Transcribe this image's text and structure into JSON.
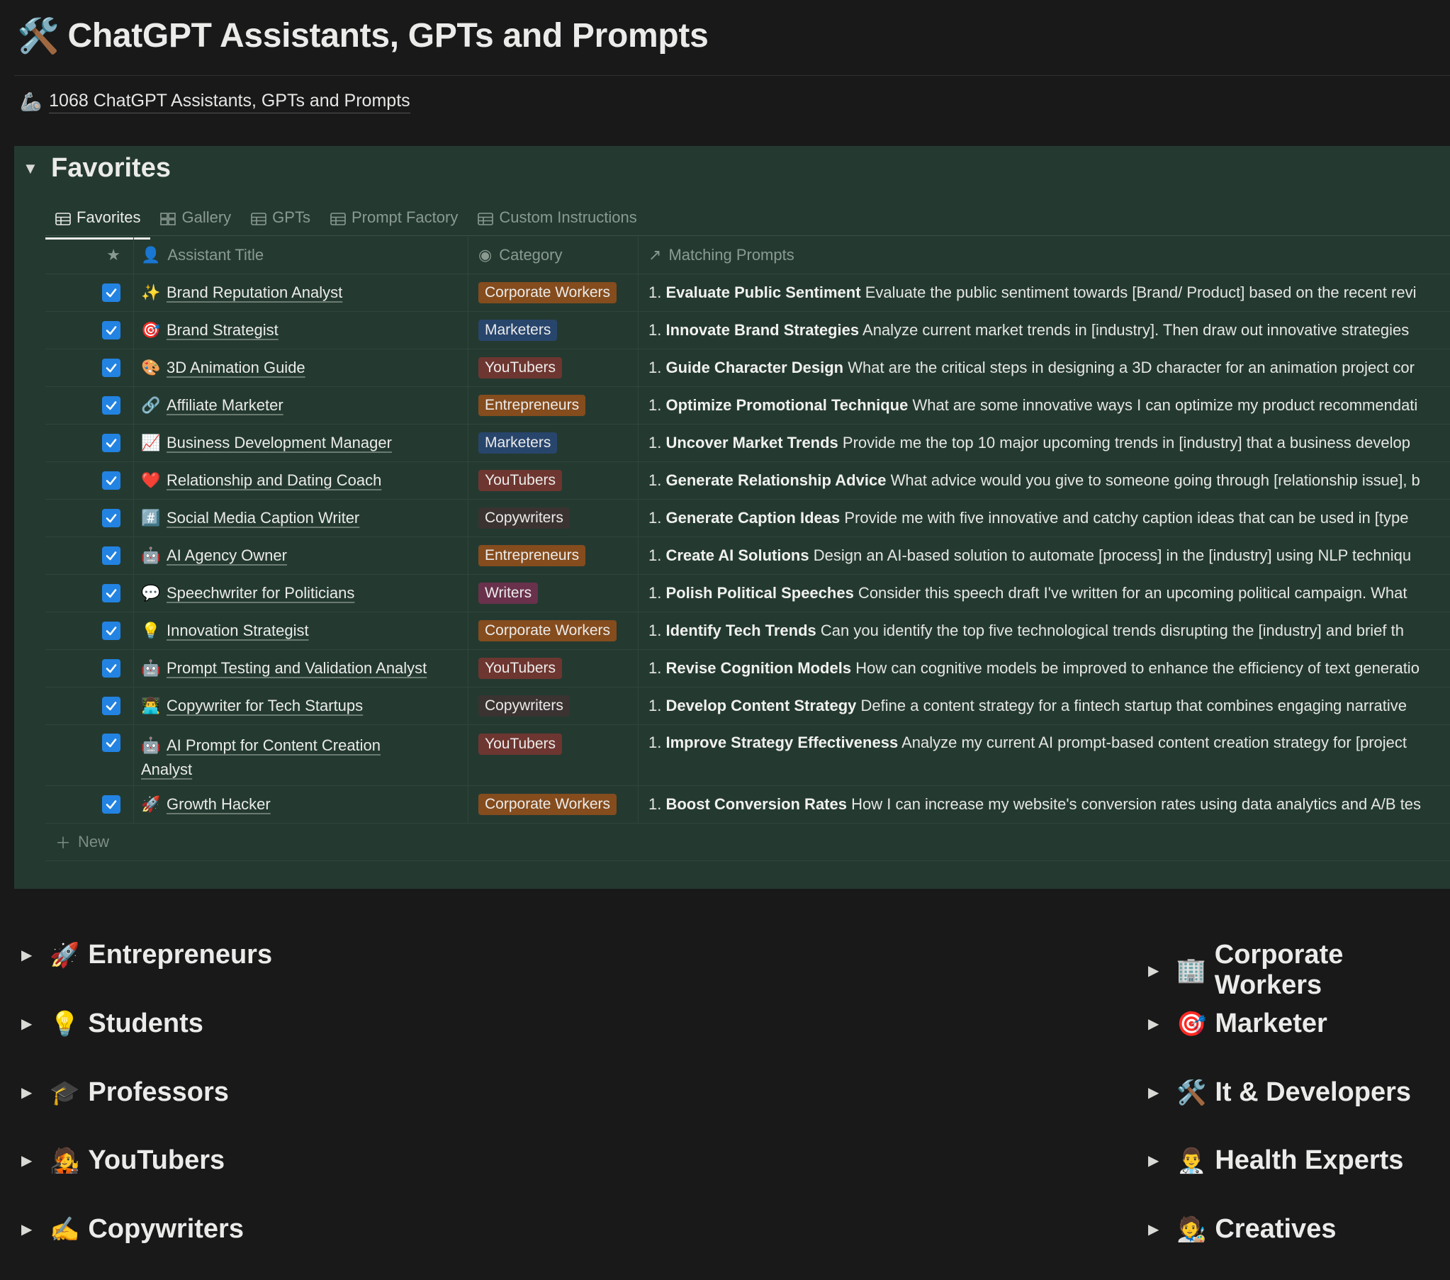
{
  "page": {
    "title_icon": "🛠️",
    "title": "ChatGPT Assistants, GPTs and Prompts",
    "subtitle_icon": "🦾",
    "subtitle": "1068 ChatGPT Assistants, GPTs and Prompts"
  },
  "favorites": {
    "title": "Favorites",
    "tabs": [
      {
        "label": "Favorites",
        "icon": "table-icon",
        "active": true
      },
      {
        "label": "Gallery",
        "icon": "gallery-icon",
        "active": false
      },
      {
        "label": "GPTs",
        "icon": "table-icon",
        "active": false
      },
      {
        "label": "Prompt Factory",
        "icon": "table-icon",
        "active": false
      },
      {
        "label": "Custom Instructions",
        "icon": "table-icon",
        "active": false
      }
    ],
    "columns": {
      "star": "star-icon",
      "title": "Assistant Title",
      "category": "Category",
      "prompts": "Matching Prompts"
    },
    "rows": [
      {
        "emoji": "✨",
        "title": "Brand Reputation Analyst",
        "category": "Corporate Workers",
        "tag": "corp",
        "prompt_title": "Evaluate Public Sentiment",
        "prompt": "Evaluate the public sentiment towards [Brand/ Product] based on the recent revi"
      },
      {
        "emoji": "🎯",
        "title": "Brand Strategist",
        "category": "Marketers",
        "tag": "mkt",
        "prompt_title": "Innovate Brand Strategies",
        "prompt": "Analyze current market trends in [industry]. Then draw out innovative strategies"
      },
      {
        "emoji": "🎨",
        "title": "3D Animation Guide",
        "category": "YouTubers",
        "tag": "yt",
        "prompt_title": "Guide Character Design",
        "prompt": "What are the critical steps in designing a 3D character for an animation project cor"
      },
      {
        "emoji": "🔗",
        "title": "Affiliate Marketer",
        "category": "Entrepreneurs",
        "tag": "ent",
        "prompt_title": "Optimize Promotional Technique",
        "prompt": "What are some innovative ways I can optimize my product recommendati"
      },
      {
        "emoji": "📈",
        "title": "Business Development Manager",
        "category": "Marketers",
        "tag": "mkt",
        "prompt_title": "Uncover Market Trends",
        "prompt": "Provide me the top 10 major upcoming trends in [industry] that a business develop"
      },
      {
        "emoji": "❤️",
        "title": "Relationship and Dating Coach",
        "category": "YouTubers",
        "tag": "yt",
        "prompt_title": "Generate Relationship Advice",
        "prompt": "What advice would you give to someone going through [relationship issue], b"
      },
      {
        "emoji": "#️⃣",
        "title": "Social Media Caption Writer",
        "category": "Copywriters",
        "tag": "copy",
        "prompt_title": "Generate Caption Ideas",
        "prompt": "Provide me with five innovative and catchy caption ideas that can be used in [type"
      },
      {
        "emoji": "🤖",
        "title": "AI Agency Owner",
        "category": "Entrepreneurs",
        "tag": "ent",
        "prompt_title": "Create AI Solutions",
        "prompt": "Design an AI-based solution to automate [process] in the [industry] using NLP techniqu"
      },
      {
        "emoji": "💬",
        "title": "Speechwriter for Politicians",
        "category": "Writers",
        "tag": "writ",
        "prompt_title": "Polish Political Speeches",
        "prompt": "Consider this speech draft I've written for an upcoming political campaign. What"
      },
      {
        "emoji": "💡",
        "title": "Innovation Strategist",
        "category": "Corporate Workers",
        "tag": "corp",
        "prompt_title": "Identify Tech Trends",
        "prompt": "Can you identify the top five technological trends disrupting the [industry] and brief th"
      },
      {
        "emoji": "🤖",
        "title": "Prompt Testing and Validation Analyst",
        "category": "YouTubers",
        "tag": "yt",
        "prompt_title": "Revise Cognition Models",
        "prompt": "How can cognitive models be improved to enhance the efficiency of text generatio"
      },
      {
        "emoji": "👨‍💻",
        "title": "Copywriter for Tech Startups",
        "category": "Copywriters",
        "tag": "copy",
        "prompt_title": "Develop Content Strategy",
        "prompt": "Define a content strategy for a fintech startup that combines engaging narrative"
      },
      {
        "emoji": "🤖",
        "title": "AI Prompt for Content Creation",
        "title2": "Analyst",
        "category": "YouTubers",
        "tag": "yt",
        "prompt_title": "Improve Strategy Effectiveness",
        "prompt": "Analyze my current AI prompt-based content creation strategy for [project"
      },
      {
        "emoji": "🚀",
        "title": "Growth Hacker",
        "category": "Corporate Workers",
        "tag": "corp",
        "prompt_title": "Boost Conversion Rates",
        "prompt": "How I can increase my website's conversion rates using data analytics and A/B tes"
      }
    ],
    "number_prefix": "1.",
    "new_label": "New"
  },
  "sections_left": [
    {
      "emoji": "🚀",
      "label": "Entrepreneurs"
    },
    {
      "emoji": "💡",
      "label": "Students"
    },
    {
      "emoji": "🎓",
      "label": "Professors"
    },
    {
      "emoji": "🧑‍🎤",
      "label": "YouTubers"
    },
    {
      "emoji": "✍️",
      "label": "Copywriters"
    }
  ],
  "sections_right": [
    {
      "emoji": "🏢",
      "label": "Corporate Workers"
    },
    {
      "emoji": "🎯",
      "label": "Marketer"
    },
    {
      "emoji": "🛠️",
      "label": "It & Developers"
    },
    {
      "emoji": "👨‍⚕️",
      "label": "Health Experts"
    },
    {
      "emoji": "🧑‍🎨",
      "label": "Creatives"
    }
  ],
  "colors": {
    "background": "#191919",
    "panel": "#243a31",
    "checkbox": "#2383e2"
  }
}
